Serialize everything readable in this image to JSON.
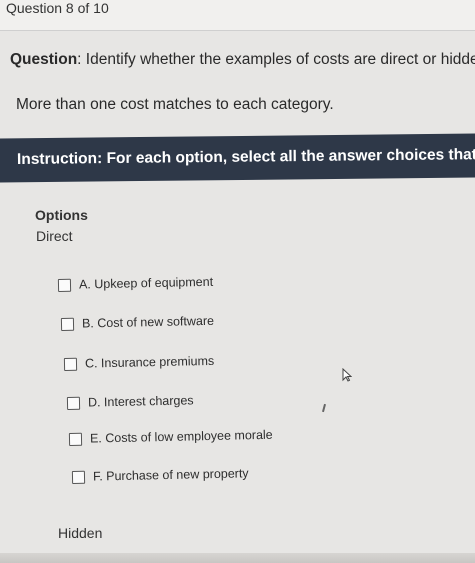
{
  "header": {
    "question_count": "Question 8 of 10"
  },
  "question": {
    "label": "Question",
    "text": ": Identify whether the examples of costs are direct or hidden."
  },
  "note": "More than one cost matches to each category.",
  "instruction": "Instruction: For each option, select all the answer choices that apply.",
  "options": {
    "heading": "Options",
    "categories": {
      "direct": "Direct",
      "hidden": "Hidden"
    },
    "items": [
      {
        "label": "A. Upkeep of equipment",
        "checked": false
      },
      {
        "label": "B. Cost of new software",
        "checked": false
      },
      {
        "label": "C. Insurance premiums",
        "checked": false
      },
      {
        "label": "D. Interest charges",
        "checked": false
      },
      {
        "label": "E. Costs of low employee morale",
        "checked": false
      },
      {
        "label": "F. Purchase of new property",
        "checked": false
      }
    ]
  }
}
